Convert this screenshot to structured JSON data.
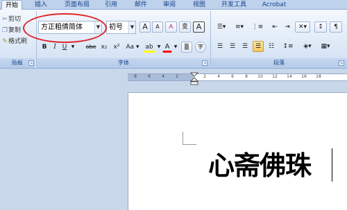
{
  "tabs": [
    {
      "label": "开始",
      "active": true
    },
    {
      "label": "插入",
      "active": false
    },
    {
      "label": "页面布局",
      "active": false
    },
    {
      "label": "引用",
      "active": false
    },
    {
      "label": "邮件",
      "active": false
    },
    {
      "label": "审阅",
      "active": false
    },
    {
      "label": "视图",
      "active": false
    },
    {
      "label": "开发工具",
      "active": false
    },
    {
      "label": "Acrobat",
      "active": false
    }
  ],
  "clipboard": {
    "cut": "剪切",
    "copy": "复制",
    "format_painter": "格式刷",
    "group_label": "贴板"
  },
  "font": {
    "font_name": "方正粗倩简体",
    "font_size": "初号",
    "group_label": "字体",
    "buttons": {
      "grow": "A",
      "shrink": "A",
      "clear": "A",
      "phonetic": "变",
      "border": "A",
      "bold": "B",
      "italic": "I",
      "underline": "U",
      "strike": "abe",
      "subscript": "x₂",
      "superscript": "x²",
      "case": "Aa",
      "highlight": "ab",
      "color": "A",
      "enclose": "字"
    }
  },
  "paragraph": {
    "group_label": "段落"
  },
  "ruler": {
    "ticks": [
      "8",
      "6",
      "4",
      "2",
      "2",
      "4",
      "6",
      "8",
      "10",
      "12",
      "14",
      "16",
      "18"
    ]
  },
  "document": {
    "text": "心斋佛珠"
  },
  "colors": {
    "annotation": "#e0262a",
    "highlight": "#ffff00",
    "font_color": "#ff0000"
  }
}
